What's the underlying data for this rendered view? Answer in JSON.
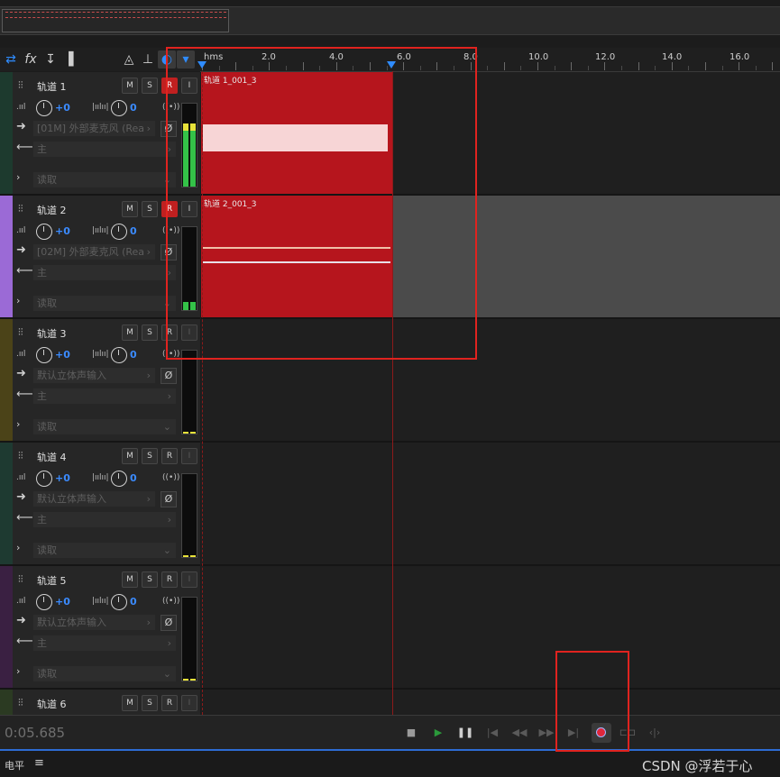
{
  "overview": {},
  "toolbar": {
    "icons": [
      "swap-icon",
      "fx-icon",
      "sort-icon",
      "levels-icon",
      "metronome-icon",
      "input-icon",
      "headphone-icon",
      "marker-icon"
    ]
  },
  "ruler": {
    "unit_label": "hms",
    "ticks": [
      "2.0",
      "4.0",
      "6.0",
      "8.0",
      "10.0",
      "12.0",
      "14.0",
      "16.0"
    ]
  },
  "tracks": [
    {
      "name": "轨道 1",
      "color": "#1d3a2e",
      "volume": "+0",
      "pan": "0",
      "input": "[01M] 外部麦克风 (Rea",
      "output": "主",
      "automation": "读取",
      "clip_label": "轨道 1_001_3",
      "armed": true
    },
    {
      "name": "轨道 2",
      "color": "#9b6ad6",
      "volume": "+0",
      "pan": "0",
      "input": "[02M] 外部麦克风 (Rea",
      "output": "主",
      "automation": "读取",
      "clip_label": "轨道 2_001_3",
      "armed": true
    },
    {
      "name": "轨道 3",
      "color": "#4b4318",
      "volume": "+0",
      "pan": "0",
      "input": "默认立体声输入",
      "output": "主",
      "automation": "读取",
      "armed": false
    },
    {
      "name": "轨道 4",
      "color": "#1e3a31",
      "volume": "+0",
      "pan": "0",
      "input": "默认立体声输入",
      "output": "主",
      "automation": "读取",
      "armed": false
    },
    {
      "name": "轨道 5",
      "color": "#3a2042",
      "volume": "+0",
      "pan": "0",
      "input": "默认立体声输入",
      "output": "主",
      "automation": "读取",
      "armed": false
    },
    {
      "name": "轨道 6",
      "color": "#2b3a22",
      "armed": false
    }
  ],
  "buttons": {
    "mute": "M",
    "solo": "S",
    "record": "R",
    "input": "I"
  },
  "transport": {
    "time": "0:05.685",
    "controls": [
      "stop",
      "play",
      "pause",
      "go-to-start",
      "rewind",
      "fast-forward",
      "go-to-end",
      "record",
      "loop",
      "skip-selection"
    ]
  },
  "status": {
    "panel_label": "电平",
    "menu_icon": "≡",
    "watermark": "CSDN @浮若于心"
  },
  "colors": {
    "clip_red": "#b6151d",
    "accent_blue": "#2f8cff",
    "annotation_red": "#e0231f"
  }
}
